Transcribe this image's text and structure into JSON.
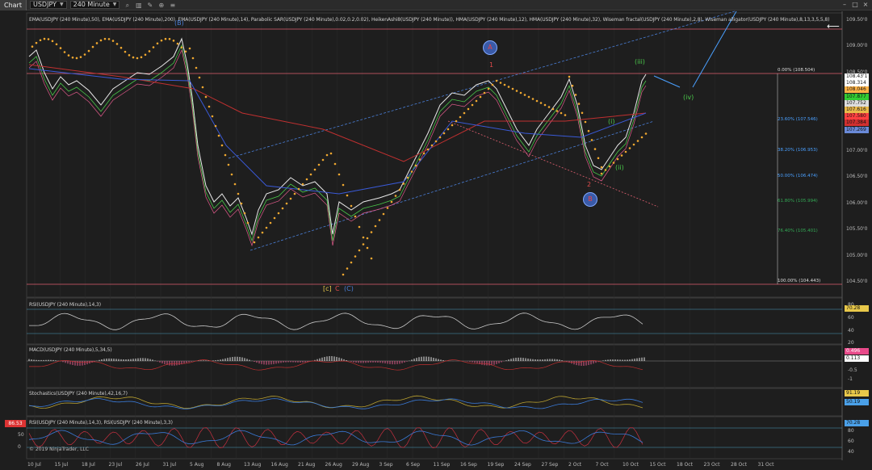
{
  "toolbar": {
    "tab_label": "Chart",
    "instrument": "USDJPY",
    "period": "240 Minute",
    "icons": [
      "search-icon",
      "chart-style-icon",
      "drawing-tool-icon",
      "zoom-icon",
      "properties-icon"
    ]
  },
  "main_panel": {
    "indicator_title": "EMA(USDJPY (240 Minute),50), EMA(USDJPY (240 Minute),200), EMA(USDJPY (240 Minute),14), Parabolic SAR(USDJPY (240 Minute),0.02,0.2,0.02), HeikenAshi8(USDJPY (240 Minute)), HMA(USDJPY (240 Minute),12), HMA(USDJPY (240 Minute),32), Wiseman fractal(USDJPY (240 Minute),2,8), Wiseman alligator(USDJPY (240 Minute),8,13,3,5,5,8)",
    "price_axis": [
      "109.50'0",
      "109.00'0",
      "108.50'0",
      "108.00'0",
      "107.50'0",
      "107.00'0",
      "106.50'0",
      "106.00'0",
      "105.50'0",
      "105.00'0",
      "104.50'0"
    ],
    "price_tags": [
      {
        "value": "108.43'1",
        "color": "#ffffff"
      },
      {
        "value": "108.314",
        "color": "#ffffff"
      },
      {
        "value": "108.046",
        "color": "#ffb347"
      },
      {
        "value": "107.877",
        "color": "#33cc33"
      },
      {
        "value": "107.752",
        "color": "#dddddd"
      },
      {
        "value": "107.616",
        "color": "#e8b84a"
      },
      {
        "value": "107.580",
        "color": "#ff4040"
      },
      {
        "value": "107.384",
        "color": "#d03030"
      },
      {
        "value": "107.269",
        "color": "#6a8ad8"
      }
    ],
    "fib_levels": [
      {
        "label": "0.00% (108.504)",
        "color": "#dddddd"
      },
      {
        "label": "23.60% (107.546)",
        "color": "#4aa0ff"
      },
      {
        "label": "38.20% (106.953)",
        "color": "#4aa0ff"
      },
      {
        "label": "50.00% (106.474)",
        "color": "#4aa0ff"
      },
      {
        "label": "61.80% (105.994)",
        "color": "#33aa55"
      },
      {
        "label": "76.40% (105.401)",
        "color": "#33aa55"
      },
      {
        "label": "100.00% (104.443)",
        "color": "#dddddd"
      }
    ],
    "wave_labels": {
      "top_left": "(B)",
      "a_circle": "A",
      "b_circle": "B",
      "one": "1",
      "two": "2",
      "iii": "(iii)",
      "iv": "(iv)",
      "i": "(i)",
      "ii": "(ii)",
      "bottom_c1": "[c]",
      "bottom_c2": "C",
      "bottom_c3": "(C)"
    }
  },
  "rsi_panel": {
    "title": "RSI(USDJPY (240 Minute),14,3)",
    "axis": [
      "80",
      "60",
      "40",
      "20"
    ],
    "tag": {
      "value": "70.28",
      "color": "#e8c84a"
    }
  },
  "macd_panel": {
    "title": "MACD(USDJPY (240 Minute),5,34,5)",
    "axis": [
      "0.5",
      "0",
      "-0.5",
      "-1"
    ],
    "tags": [
      {
        "value": "0.496",
        "color": "#e84a8a"
      },
      {
        "value": "0.113",
        "color": "#ffffff"
      }
    ]
  },
  "stoch_panel": {
    "title": "Stochastics(USDJPY (240 Minute),42,16,7)",
    "tags": [
      {
        "value": "91.19",
        "color": "#e8c84a"
      },
      {
        "value": "50.19",
        "color": "#4aa0e8"
      }
    ]
  },
  "rsi2_panel": {
    "title": "RSI(USDJPY (240 Minute),14,3), RSI(USDJPY (240 Minute),3,3)",
    "left_tag": "86.53",
    "left_axis": [
      "50",
      "0"
    ],
    "axis": [
      "80",
      "60",
      "40",
      "20"
    ],
    "tag": {
      "value": "70.28",
      "color": "#4aa0e8"
    }
  },
  "copyright": "© 2019 NinjaTrader, LLC",
  "date_axis": [
    "10 Jul",
    "15 Jul",
    "18 Jul",
    "23 Jul",
    "26 Jul",
    "31 Jul",
    "5 Aug",
    "8 Aug",
    "13 Aug",
    "16 Aug",
    "21 Aug",
    "26 Aug",
    "29 Aug",
    "3 Sep",
    "6 Sep",
    "11 Sep",
    "16 Sep",
    "19 Sep",
    "24 Sep",
    "27 Sep",
    "2 Oct",
    "7 Oct",
    "10 Oct",
    "15 Oct",
    "18 Oct",
    "23 Oct",
    "28 Oct",
    "31 Oct"
  ]
}
